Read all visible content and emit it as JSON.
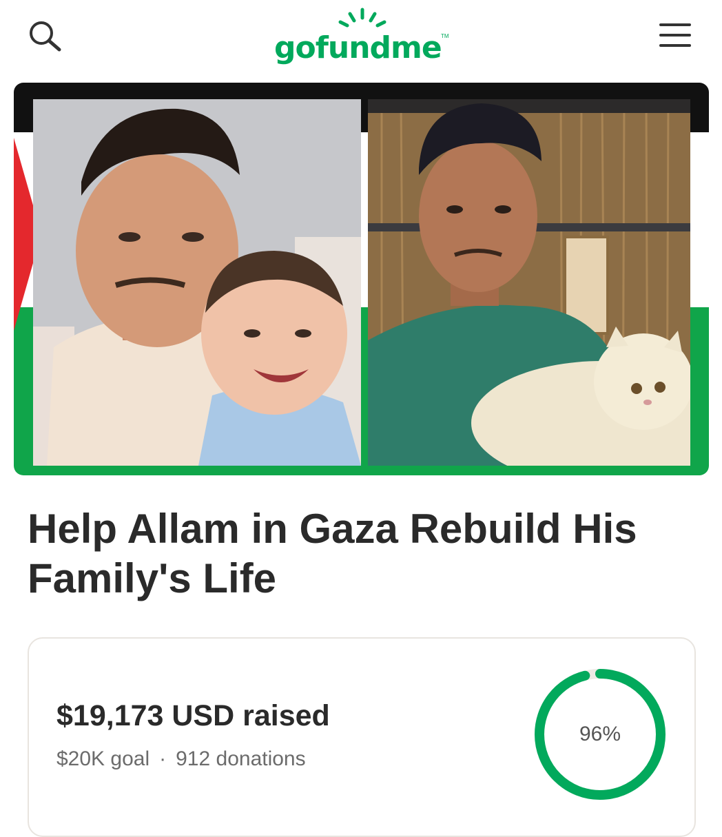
{
  "header": {
    "logo_text": "gofundme",
    "logo_tm": "TM",
    "search_icon": "search-icon",
    "menu_icon": "hamburger-menu-icon",
    "brand_color": "#02a95c"
  },
  "hero": {
    "description": "Palestinian flag background with two photos",
    "flag_colors": {
      "black": "#111111",
      "white": "#ffffff",
      "green": "#10a54a",
      "red": "#e4282d"
    }
  },
  "campaign": {
    "title": "Help Allam in Gaza Rebuild His Family's Life"
  },
  "progress": {
    "raised_text": "$19,173 USD raised",
    "goal_text": "$20K goal",
    "separator": "·",
    "donations_text": "912 donations",
    "percent_text": "96%",
    "percent_value": 0.96,
    "ring_color": "#02a95c",
    "track_color": "#ece9e4"
  }
}
